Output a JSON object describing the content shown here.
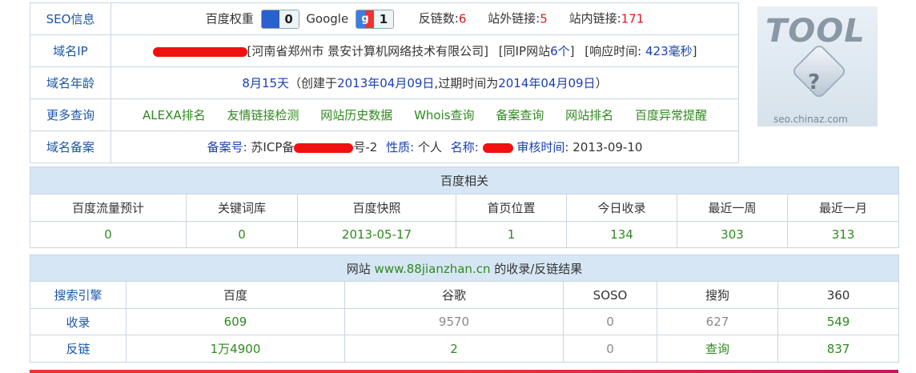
{
  "info": {
    "seo": {
      "label": "SEO信息",
      "baidu_weight_label": "百度权重",
      "baidu_weight": "0",
      "google_label": "Google",
      "google_pr": "1",
      "backlinks_label": "反链数:",
      "backlinks": "6",
      "external_label": "站外链接:",
      "external": "5",
      "internal_label": "站内链接:",
      "internal": "171"
    },
    "ip": {
      "label": "域名IP",
      "location": "[河南省郑州市 景安计算机网络技术有限公司]",
      "same_ip_prefix": "[同IP网站",
      "same_ip_count": "6个",
      "same_ip_suffix": "]",
      "resp_prefix": "[响应时间:",
      "resp_time": "423毫秒",
      "resp_suffix": "]"
    },
    "age": {
      "label": "域名年龄",
      "age": "8月15天",
      "created_prefix": "（创建于",
      "created": "2013年04月09日",
      "expire_prefix": ",过期时间为",
      "expire": "2014年04月09日",
      "suffix": "）"
    },
    "more": {
      "label": "更多查询",
      "links": [
        "ALEXA排名",
        "友情链接检测",
        "网站历史数据",
        "Whois查询",
        "备案查询",
        "网站排名",
        "百度异常提醒"
      ]
    },
    "icp": {
      "label": "域名备案",
      "num_label": "备案号:",
      "num_prefix": "苏ICP备",
      "num_suffix": "号-2",
      "nature_label": "性质:",
      "nature": "个人",
      "name_label": "名称:",
      "audit_label": "审核时间:",
      "audit": "2013-09-10"
    }
  },
  "logo": {
    "text": "TOOL",
    "site": "seo.chinaz.com"
  },
  "baidu": {
    "title": "百度相关",
    "headers": [
      "百度流量预计",
      "关键词库",
      "百度快照",
      "首页位置",
      "今日收录",
      "最近一周",
      "最近一月"
    ],
    "values": [
      "0",
      "0",
      "2013-05-17",
      "1",
      "134",
      "303",
      "313"
    ]
  },
  "index": {
    "title_prefix": "网站",
    "domain": "www.88jianzhan.cn",
    "title_suffix": "的收录/反链结果",
    "headers": [
      "搜索引擎",
      "百度",
      "谷歌",
      "SOSO",
      "搜狗",
      "360"
    ],
    "rows": [
      {
        "label": "收录",
        "values": [
          "609",
          "9570",
          "0",
          "627",
          "549"
        ]
      },
      {
        "label": "反链",
        "values": [
          "1万4900",
          "2",
          "0",
          "查询",
          "837"
        ]
      }
    ]
  },
  "colors": {
    "label_blue": "#1a56a8",
    "value_blue": "#1a3fb5",
    "red": "#e01818",
    "green": "#2f8a1e",
    "gray": "#8a8a8a",
    "header_bg": "#d7e6f5",
    "border": "#c9d6e3"
  }
}
